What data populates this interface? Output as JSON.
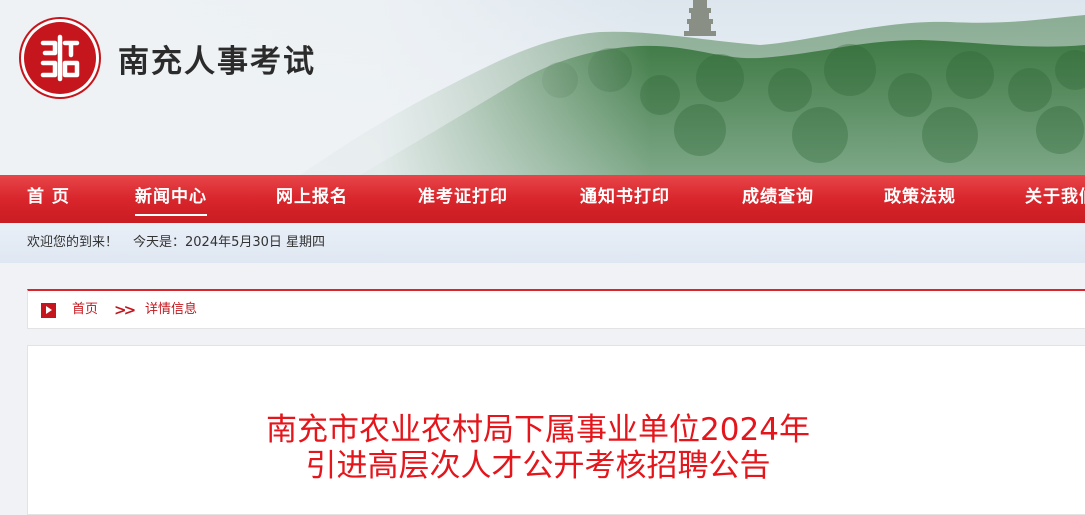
{
  "site": {
    "name": "南充人事考试",
    "logo_icon": "seal-logo-icon",
    "brand_color": "#c4161c"
  },
  "nav": {
    "items": [
      {
        "label": "首 页",
        "active": false
      },
      {
        "label": "新闻中心",
        "active": true
      },
      {
        "label": "网上报名",
        "active": false
      },
      {
        "label": "准考证打印",
        "active": false
      },
      {
        "label": "通知书打印",
        "active": false
      },
      {
        "label": "成绩查询",
        "active": false
      },
      {
        "label": "政策法规",
        "active": false
      },
      {
        "label": "关于我们",
        "active": false
      }
    ]
  },
  "welcome": {
    "greeting": "欢迎您的到来！",
    "date": "今天是：2024年5月30日 星期四"
  },
  "breadcrumb": {
    "home": "首页",
    "separator": ">>",
    "current": "详情信息"
  },
  "article": {
    "title_line1": "南充市农业农村局下属事业单位2024年",
    "title_line2": "引进高层次人才公开考核招聘公告"
  }
}
